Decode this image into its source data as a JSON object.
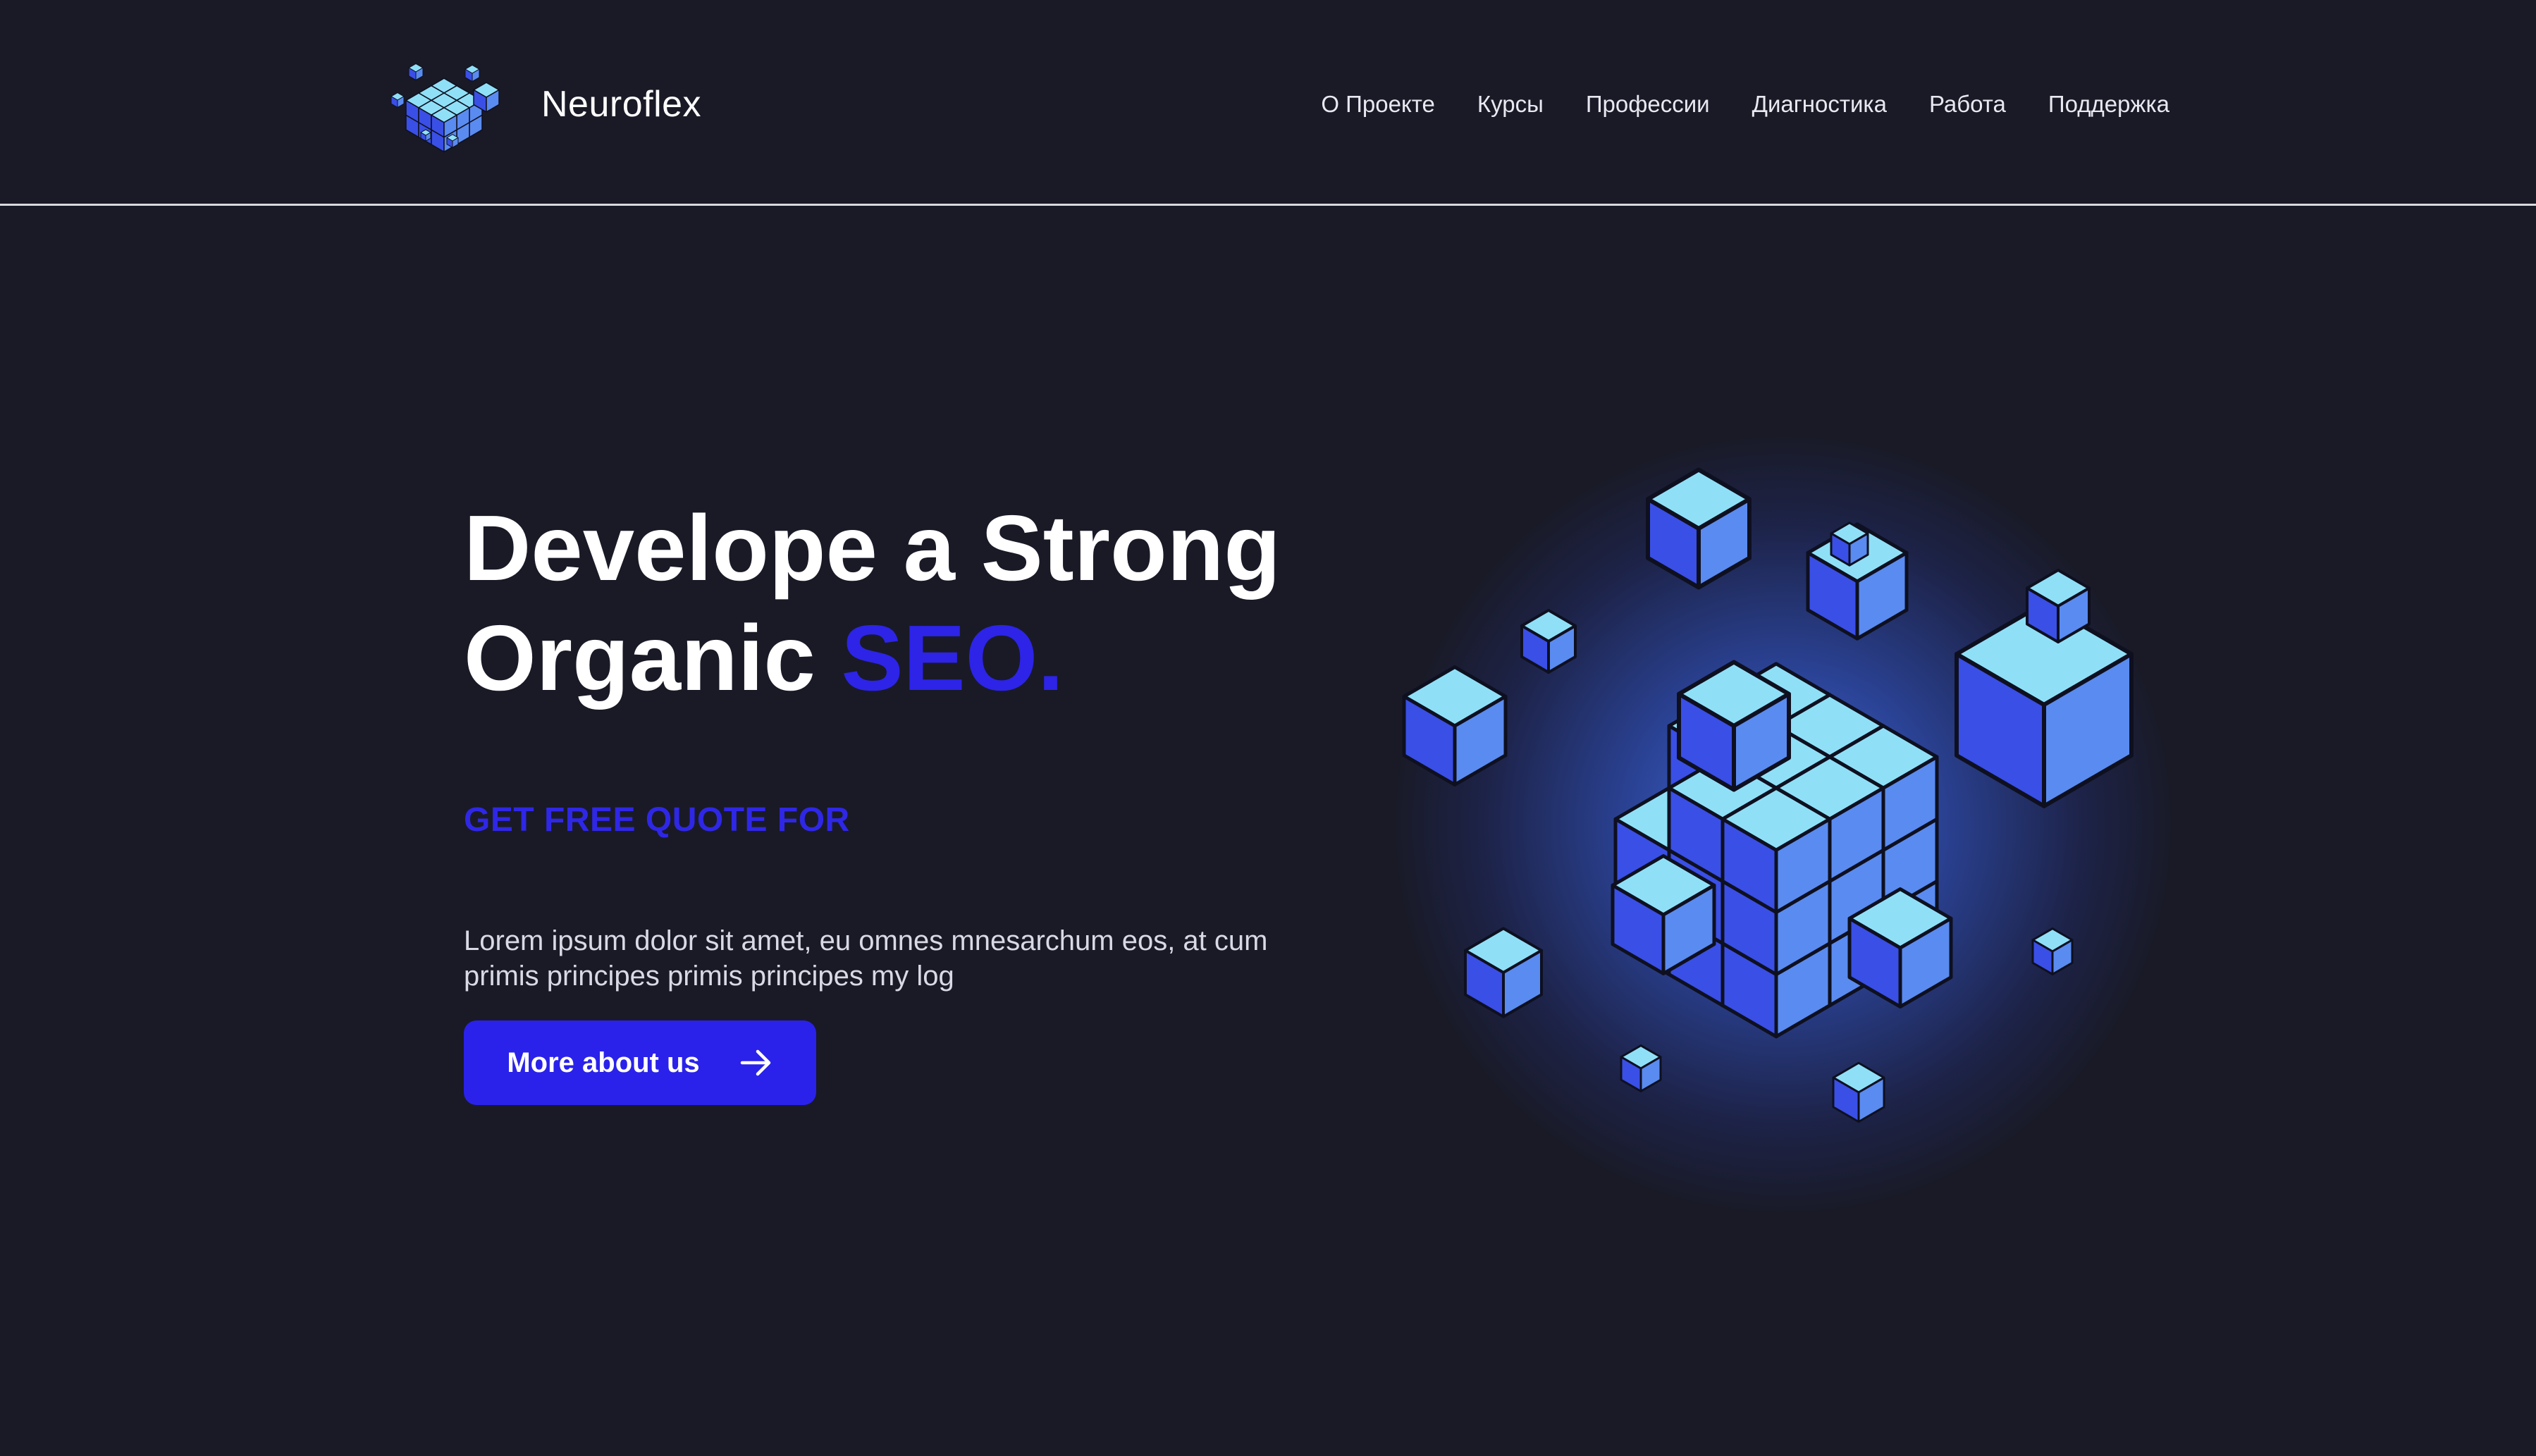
{
  "brand": {
    "name": "Neuroflex",
    "logo_icon": "cubes-logo-icon"
  },
  "nav": {
    "items": [
      {
        "label": "О Проекте"
      },
      {
        "label": "Курсы"
      },
      {
        "label": "Профессии"
      },
      {
        "label": "Диагностика"
      },
      {
        "label": "Работа"
      },
      {
        "label": "Поддержка"
      }
    ]
  },
  "hero": {
    "title_line1": "Develope a Strong",
    "title_line2_plain": "Organic",
    "title_line2_accent": "SEO.",
    "eyebrow": "GET FREE QUOTE FOR",
    "description": "Lorem ipsum dolor sit amet, eu omnes mnesarchum eos, at cum primis principes primis principes my log",
    "cta_label": "More about us",
    "cta_icon": "arrow-right-icon",
    "illustration": "isometric-cubes-illustration"
  },
  "colors": {
    "background": "#191a26",
    "accent": "#2d24e8",
    "cube_top": "#8fe0f7",
    "cube_left": "#3a4fe6",
    "cube_right": "#5a8bf0"
  }
}
